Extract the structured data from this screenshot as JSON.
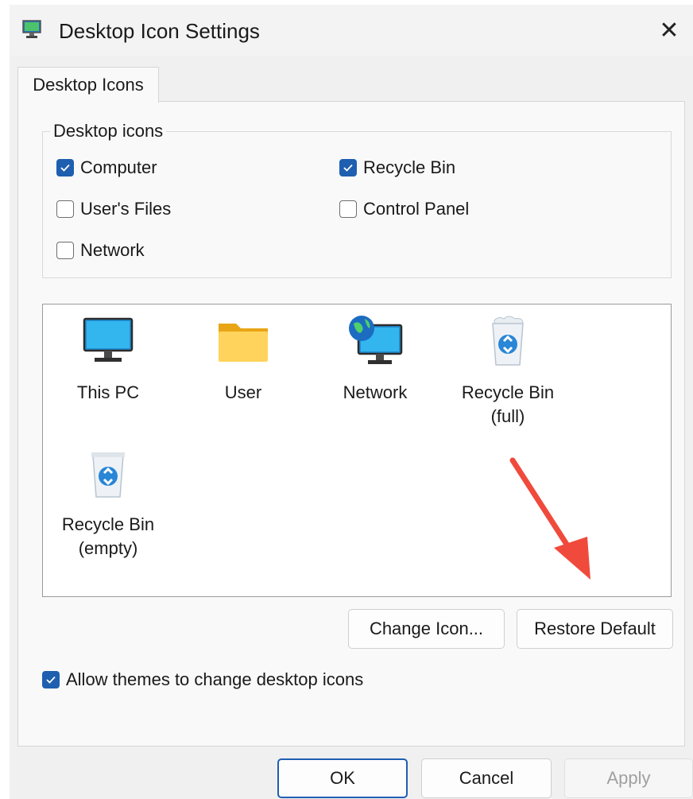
{
  "window": {
    "title": "Desktop Icon Settings",
    "close_glyph": "✕"
  },
  "tabs": [
    {
      "label": "Desktop Icons",
      "active": true
    }
  ],
  "group": {
    "legend": "Desktop icons",
    "checkboxes": [
      {
        "label": "Computer",
        "checked": true
      },
      {
        "label": "Recycle Bin",
        "checked": true
      },
      {
        "label": "User's Files",
        "checked": false
      },
      {
        "label": "Control Panel",
        "checked": false
      },
      {
        "label": "Network",
        "checked": false
      }
    ]
  },
  "preview": {
    "items": [
      {
        "label": "This PC",
        "icon": "monitor-icon"
      },
      {
        "label": "User",
        "icon": "folder-icon"
      },
      {
        "label": "Network",
        "icon": "network-globe-icon"
      },
      {
        "label": "Recycle Bin\n(full)",
        "label_line1": "Recycle Bin",
        "label_line2": "(full)",
        "icon": "recycle-bin-full-icon"
      },
      {
        "label_line1": "Recycle Bin",
        "label_line2": "(empty)",
        "icon": "recycle-bin-empty-icon"
      }
    ]
  },
  "buttons": {
    "change_icon": "Change Icon...",
    "restore_default": "Restore Default",
    "ok": "OK",
    "cancel": "Cancel",
    "apply": "Apply"
  },
  "allow_themes": {
    "label": "Allow themes to change desktop icons",
    "checked": true
  },
  "colors": {
    "accent": "#1f5fb0",
    "annotation_arrow": "#f04a3c"
  }
}
